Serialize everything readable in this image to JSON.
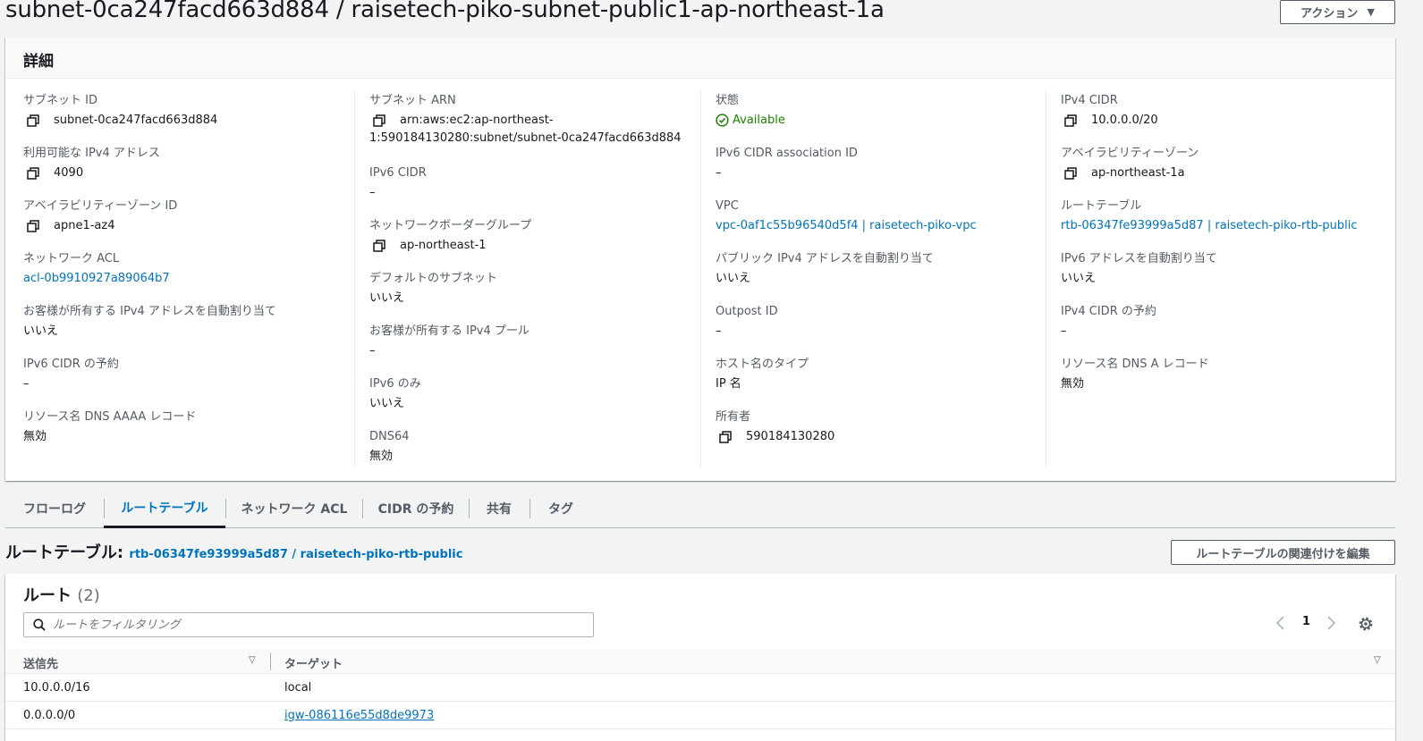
{
  "page": {
    "title": "subnet-0ca247facd663d884 / raisetech-piko-subnet-public1-ap-northeast-1a",
    "actions_label": "アクション"
  },
  "details": {
    "header": "詳細",
    "col1": [
      {
        "label": "サブネット ID",
        "value": "subnet-0ca247facd663d884"
      },
      {
        "label": "利用可能な IPv4 アドレス",
        "value": "4090"
      },
      {
        "label": "アベイラビリティーゾーン ID",
        "value": "apne1-az4"
      },
      {
        "label": "ネットワーク ACL",
        "value": "acl-0b9910927a89064b7"
      },
      {
        "label": "お客様が所有する IPv4 アドレスを自動割り当て",
        "value": "いいえ"
      },
      {
        "label": "IPv6 CIDR の予約",
        "value": "–"
      },
      {
        "label": "リソース名 DNS AAAA レコード",
        "value": "無効"
      }
    ],
    "col2": [
      {
        "label": "サブネット ARN",
        "value_line1": "arn:aws:ec2:ap-northeast-",
        "value_line2": "1:590184130280:subnet/subnet-0ca247facd663d884"
      },
      {
        "label": "IPv6 CIDR",
        "value": "–"
      },
      {
        "label": "ネットワークボーダーグループ",
        "value": "ap-northeast-1"
      },
      {
        "label": "デフォルトのサブネット",
        "value": "いいえ"
      },
      {
        "label": "お客様が所有する IPv4 プール",
        "value": "–"
      },
      {
        "label": "IPv6 のみ",
        "value": "いいえ"
      },
      {
        "label": "DNS64",
        "value": "無効"
      }
    ],
    "col3": [
      {
        "label": "状態",
        "value": "Available"
      },
      {
        "label": "IPv6 CIDR association ID",
        "value": "–"
      },
      {
        "label": "VPC",
        "value": "vpc-0af1c55b96540d5f4 | raisetech-piko-vpc"
      },
      {
        "label": "パブリック IPv4 アドレスを自動割り当て",
        "value": "いいえ"
      },
      {
        "label": "Outpost ID",
        "value": "–"
      },
      {
        "label": "ホスト名のタイプ",
        "value": "IP 名"
      },
      {
        "label": "所有者",
        "value": "590184130280"
      }
    ],
    "col4": [
      {
        "label": "IPv4 CIDR",
        "value": "10.0.0.0/20"
      },
      {
        "label": "アベイラビリティーゾーン",
        "value": "ap-northeast-1a"
      },
      {
        "label": "ルートテーブル",
        "value": "rtb-06347fe93999a5d87 | raisetech-piko-rtb-public"
      },
      {
        "label": "IPv6 アドレスを自動割り当て",
        "value": "いいえ"
      },
      {
        "label": "IPv4 CIDR の予約",
        "value": "–"
      },
      {
        "label": "リソース名 DNS A レコード",
        "value": "無効"
      }
    ]
  },
  "tabs": [
    "フローログ",
    "ルートテーブル",
    "ネットワーク ACL",
    "CIDR の予約",
    "共有",
    "タグ"
  ],
  "route_table": {
    "title_label": "ルートテーブル:",
    "title_link": "rtb-06347fe93999a5d87 / raisetech-piko-rtb-public",
    "edit_button": "ルートテーブルの関連付けを編集"
  },
  "routes": {
    "heading": "ルート",
    "count": "(2)",
    "filter_placeholder": "ルートをフィルタリング",
    "page_number": "1",
    "columns": [
      "送信先",
      "ターゲット"
    ],
    "rows": [
      {
        "destination": "10.0.0.0/16",
        "target": "local"
      },
      {
        "destination": "0.0.0.0/0",
        "target": "igw-086116e55d8de9973"
      }
    ]
  },
  "colors": {
    "accent": "#0073bb",
    "status_ok": "#1d8102"
  }
}
